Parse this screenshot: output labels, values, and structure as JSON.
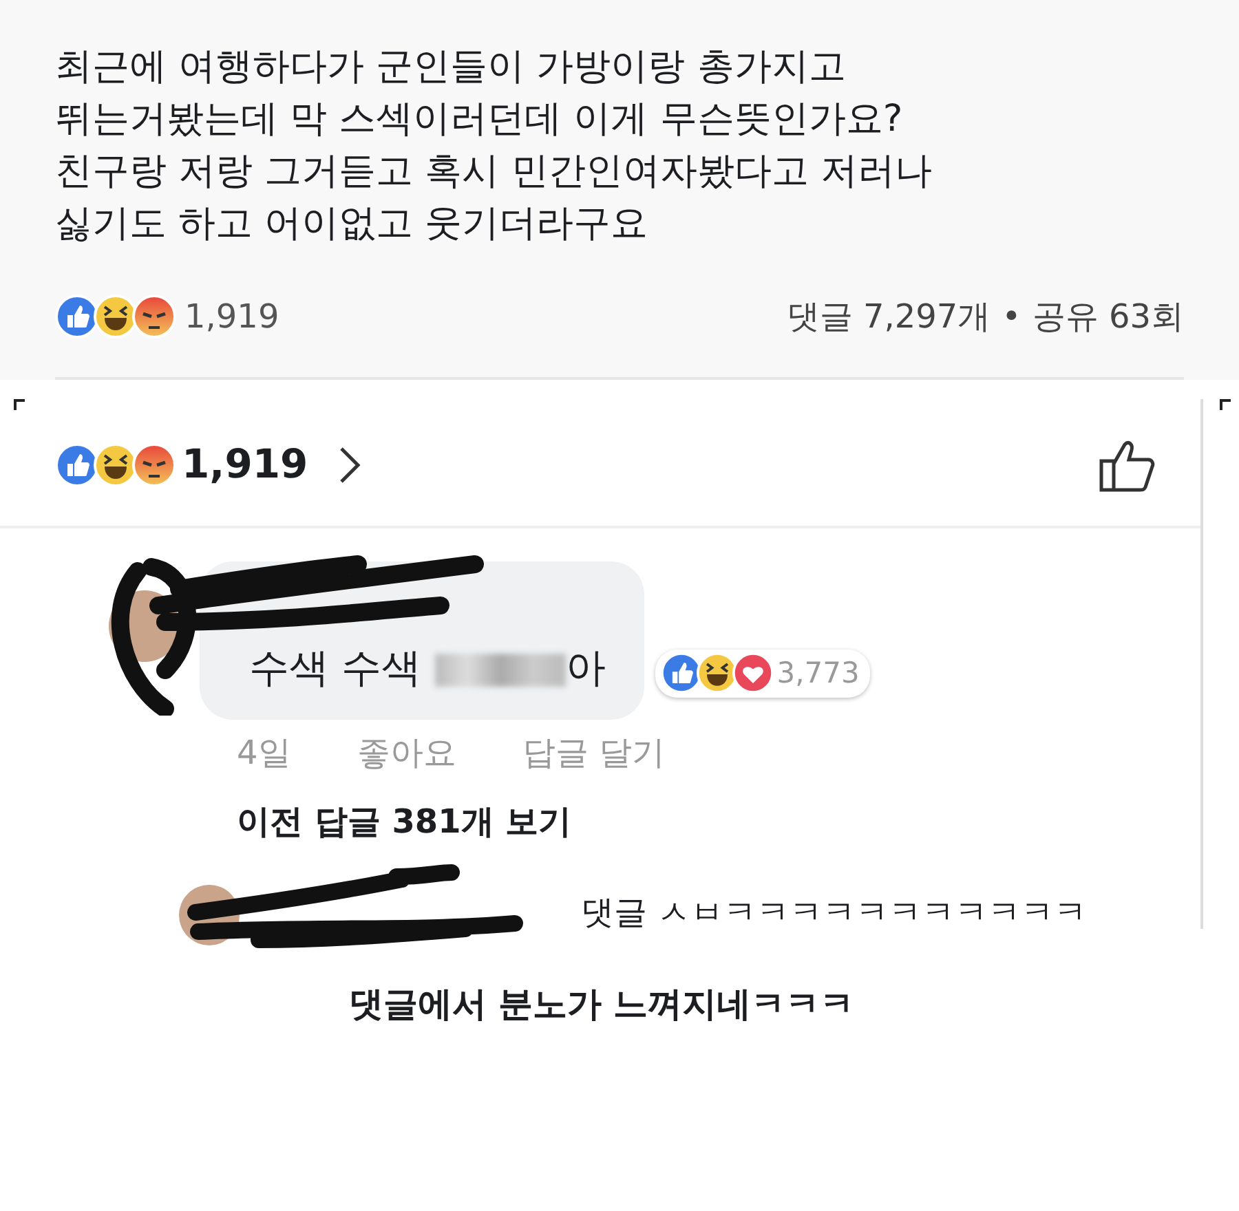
{
  "post": {
    "text_lines": [
      "최근에 여행하다가 군인들이 가방이랑 총가지고",
      "뛰는거봤는데 막 스섹이러던데 이게 무슨뜻인가요?",
      "친구랑 저랑 그거듣고 혹시 민간인여자봤다고 저러나",
      "싫기도 하고 어이없고 웃기더라구요"
    ],
    "reactions": [
      {
        "kind": "like"
      },
      {
        "kind": "haha"
      },
      {
        "kind": "angry"
      }
    ],
    "reaction_count": "1,919",
    "comments_count": "댓글 7,297개",
    "separator": "•",
    "shares": "공유 63회"
  },
  "detail": {
    "reactions": [
      {
        "kind": "like"
      },
      {
        "kind": "haha"
      },
      {
        "kind": "angry"
      }
    ],
    "reaction_count": "1,919",
    "comment": {
      "text_before": "수색 수색",
      "redacted": true,
      "text_after": "아",
      "reactions": [
        {
          "kind": "like"
        },
        {
          "kind": "haha"
        },
        {
          "kind": "love"
        }
      ],
      "reaction_count": "3,773",
      "time": "4일",
      "like_action": "좋아요",
      "reply_action": "답글 달기"
    },
    "view_replies": "이전 답글 381개 보기",
    "reply": {
      "text": "댓글 ㅅㅂㅋㅋㅋㅋㅋㅋㅋㅋㅋㅋㅋ"
    }
  },
  "caption": "댓글에서 분노가 느껴지네ㅋㅋㅋ"
}
